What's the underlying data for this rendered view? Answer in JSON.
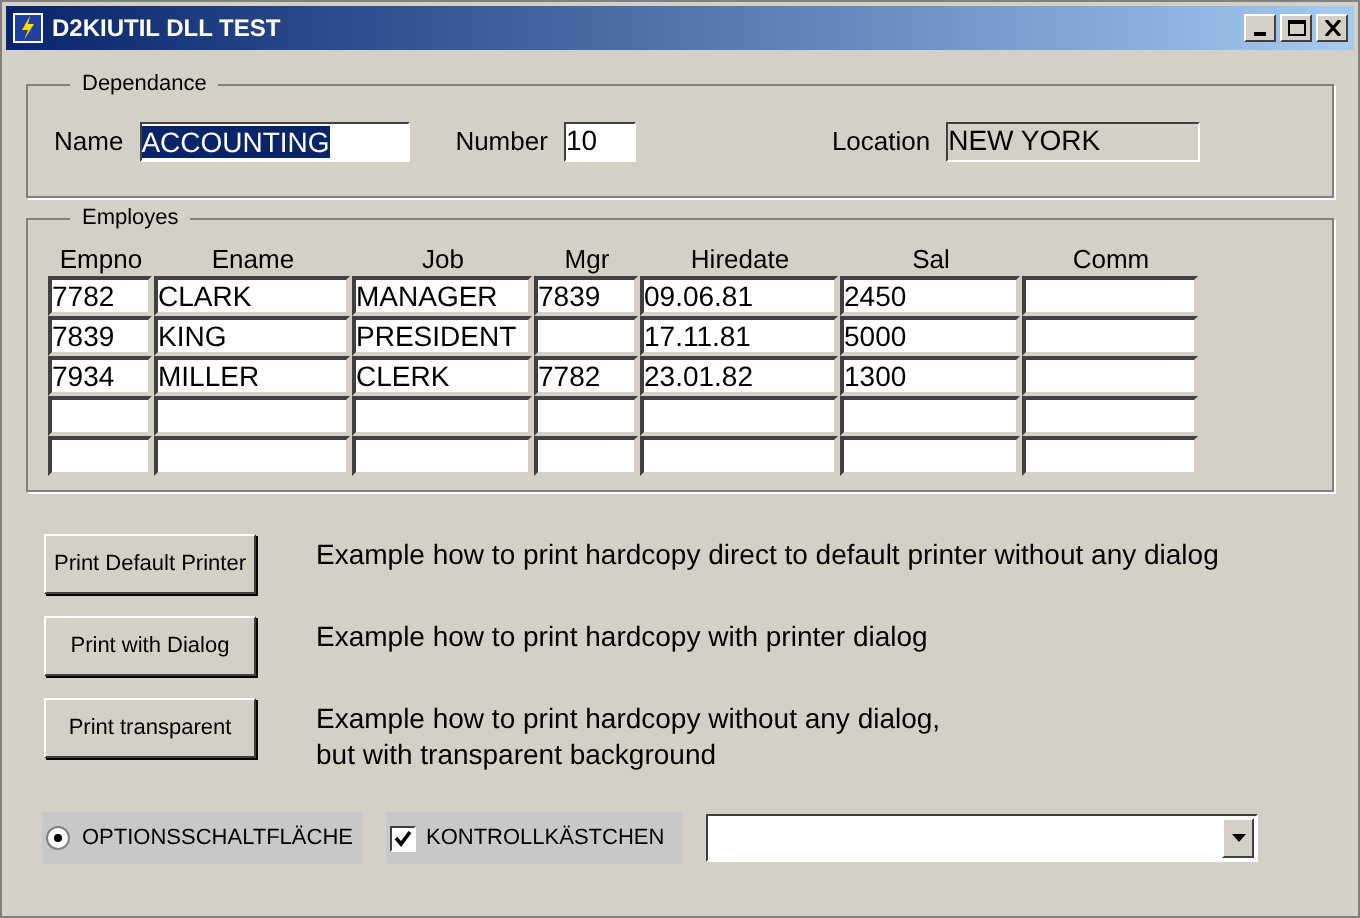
{
  "window": {
    "title": "D2KIUTIL DLL TEST"
  },
  "dependance": {
    "title": "Dependance",
    "name_label": "Name",
    "name_value": "ACCOUNTING",
    "number_label": "Number",
    "number_value": "10",
    "location_label": "Location",
    "location_value": "NEW YORK"
  },
  "employes": {
    "title": "Employes",
    "columns": [
      "Empno",
      "Ename",
      "Job",
      "Mgr",
      "Hiredate",
      "Sal",
      "Comm"
    ],
    "rows": [
      [
        "7782",
        "CLARK",
        "MANAGER",
        "7839",
        "09.06.81",
        "2450",
        null
      ],
      [
        "7839",
        "KING",
        "PRESIDENT",
        null,
        "17.11.81",
        "5000",
        null
      ],
      [
        "7934",
        "MILLER",
        "CLERK",
        "7782",
        "23.01.82",
        "1300",
        null
      ],
      [
        null,
        null,
        null,
        null,
        null,
        null,
        null
      ],
      [
        null,
        null,
        null,
        null,
        null,
        null,
        null
      ]
    ]
  },
  "actions": [
    {
      "button": "Print Default Printer",
      "description": [
        "Example how to print hardcopy direct to default printer without any dialog"
      ]
    },
    {
      "button": "Print with Dialog",
      "description": [
        "Example how to print hardcopy with printer dialog"
      ]
    },
    {
      "button": "Print transparent",
      "description": [
        "Example how to print hardcopy without any dialog,",
        "but with transparent background"
      ]
    }
  ],
  "radio": {
    "label": "OPTIONSSCHALTFLÄCHE",
    "selected": true
  },
  "checkbox": {
    "label": "KONTROLLKÄSTCHEN",
    "checked": true
  }
}
